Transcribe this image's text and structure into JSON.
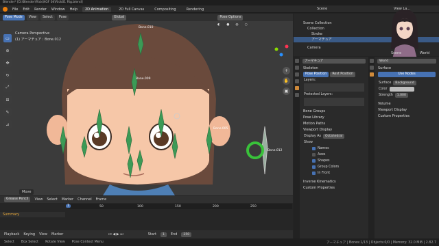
{
  "window": {
    "title": "Blender* [D:\\Blender\\Rick\\KGF 04\\Rick01 Rig.blend]"
  },
  "menu": {
    "items": [
      "File",
      "Edit",
      "Render",
      "Window",
      "Help"
    ]
  },
  "workspaces": [
    "2D Animation",
    "2D Full Canvas",
    "Compositing",
    "Rendering"
  ],
  "top_right": {
    "scene_label": "Scene",
    "view_layer_label": "View La..."
  },
  "viewport": {
    "mode": "Pose Mode",
    "menus": [
      "View",
      "Select",
      "Pose"
    ],
    "transform": "Global",
    "pose_options": "Pose Options",
    "info_line1": "Camera Perspective",
    "info_line2": "(1) アーマチュア : Bone.012",
    "bones": [
      "Bone.010",
      "Bone.009",
      "Bone.005",
      "Bone.012"
    ],
    "last_op": "Move"
  },
  "outliner": {
    "scene_collection": "Scene Collection",
    "collection": "Collection",
    "items": [
      "Stroke",
      "アーマチュア"
    ],
    "camera": "Camera"
  },
  "props_left": {
    "object_name": "アーマチュア",
    "skeleton": "Skeleton",
    "pose_position": "Pose Position",
    "rest_position": "Rest Position",
    "layers": "Layers:",
    "protected_layers": "Protected Layers:",
    "panels": [
      "Bone Groups",
      "Pose Library",
      "Motion Paths",
      "Viewport Display"
    ],
    "display_as_label": "Display As",
    "display_as_value": "Octahedral",
    "show_label": "Show",
    "show_items": [
      "Names",
      "Axes",
      "Shapes",
      "Group Colors",
      "In Front"
    ],
    "show_checked": [
      true,
      false,
      true,
      true,
      true
    ],
    "panels_bottom": [
      "Inverse Kinematics",
      "Custom Properties"
    ]
  },
  "props_right": {
    "scene_tab": "Scene",
    "world_tab": "World",
    "world_name": "World",
    "surface": "Surface",
    "use_nodes": "Use Nodes",
    "surface_label": "Surface",
    "surface_value": "Background",
    "color_label": "Color",
    "strength_label": "Strength",
    "strength_value": "1.000",
    "panels": [
      "Volume",
      "Viewport Display",
      "Custom Properties"
    ]
  },
  "timeline": {
    "mode": "Grease Pencil",
    "menus": [
      "View",
      "Select",
      "Marker",
      "Channel",
      "Frame"
    ],
    "summary": "Summary",
    "ticks": [
      "1",
      "50",
      "100",
      "150",
      "200",
      "250"
    ],
    "current_frame": "1",
    "playback": "Playback",
    "keying": "Keying",
    "view": "View",
    "marker": "Marker",
    "start_label": "Start",
    "start_value": "1",
    "end_label": "End",
    "end_value": "250"
  },
  "status": {
    "items": [
      "Select",
      "Box Select",
      "Rotate View",
      "Pose Context Menu"
    ],
    "stats": "アーマチュア | Bones:1/13 | Objects:0/0 | Memory: 32.0 MiB | 2.82.7"
  },
  "colors": {
    "accent": "#4772b3",
    "skin": "#f6c7a8",
    "hair": "#6a4a3c",
    "bone": "#3c9a56"
  }
}
